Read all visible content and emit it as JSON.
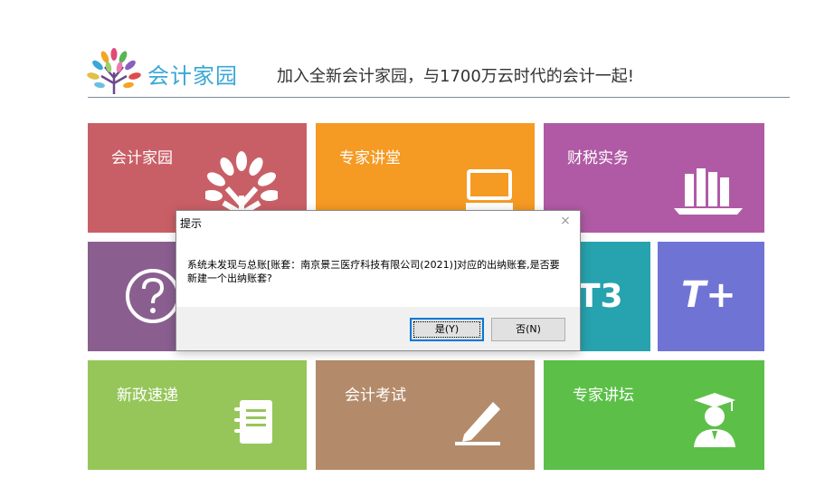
{
  "header": {
    "brand": "会计家园",
    "slogan": "加入全新会计家园，与1700万云时代的会计一起!",
    "logo_icon": "tree-logo-icon"
  },
  "tiles": [
    {
      "label": "会计家园",
      "color": "#c95f66",
      "icon": "tree-icon"
    },
    {
      "label": "专家讲堂",
      "color": "#f59a23",
      "icon": "laptop-icon"
    },
    {
      "label": "财税实务",
      "color": "#b05aa5",
      "icon": "books-icon"
    },
    {
      "label": "",
      "color": "#8a5f90",
      "icon": "help-circle-icon"
    },
    {
      "label": "T3",
      "color": "#26a3ae",
      "icon": "t3-logo-icon"
    },
    {
      "label": "T+",
      "color": "#6f74d4",
      "icon": "t-plus-logo-icon"
    },
    {
      "label": "新政速递",
      "color": "#96c65a",
      "icon": "notebook-icon"
    },
    {
      "label": "会计考试",
      "color": "#b38b6b",
      "icon": "pen-icon"
    },
    {
      "label": "专家讲坛",
      "color": "#5cc048",
      "icon": "expert-icon"
    }
  ],
  "dialog": {
    "title": "提示",
    "message": "系统未发现与总账[账套：南京景三医疗科技有限公司(2021)]对应的出纳账套,是否要新建一个出纳账套?",
    "yes_label": "是(Y)",
    "no_label": "否(N)",
    "close_glyph": "×"
  }
}
